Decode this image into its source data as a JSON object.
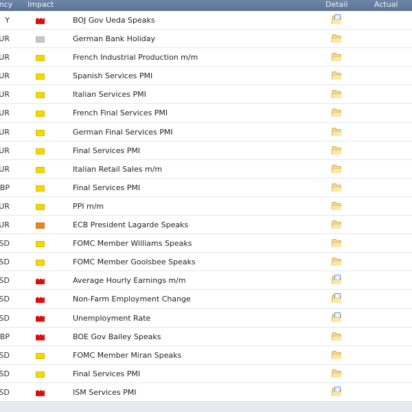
{
  "header": {
    "currency": "ency",
    "impact": "Impact",
    "detail": "Detail",
    "actual": "Actual"
  },
  "rows": [
    {
      "currency": "Y",
      "impact": "high",
      "event": "BOJ Gov Ueda Speaks",
      "detail_icon": "folder-doc-icon"
    },
    {
      "currency": "UR",
      "impact": "holiday",
      "event": "German Bank Holiday",
      "detail_icon": "folder-icon"
    },
    {
      "currency": "UR",
      "impact": "low",
      "event": "French Industrial Production m/m",
      "detail_icon": "folder-icon"
    },
    {
      "currency": "UR",
      "impact": "low",
      "event": "Spanish Services PMI",
      "detail_icon": "folder-icon"
    },
    {
      "currency": "UR",
      "impact": "low",
      "event": "Italian Services PMI",
      "detail_icon": "folder-icon"
    },
    {
      "currency": "UR",
      "impact": "low",
      "event": "French Final Services PMI",
      "detail_icon": "folder-icon"
    },
    {
      "currency": "UR",
      "impact": "low",
      "event": "German Final Services PMI",
      "detail_icon": "folder-icon"
    },
    {
      "currency": "UR",
      "impact": "low",
      "event": "Final Services PMI",
      "detail_icon": "folder-icon"
    },
    {
      "currency": "UR",
      "impact": "low",
      "event": "Italian Retail Sales m/m",
      "detail_icon": "folder-icon"
    },
    {
      "currency": "BP",
      "impact": "low",
      "event": "Final Services PMI",
      "detail_icon": "folder-icon"
    },
    {
      "currency": "UR",
      "impact": "low",
      "event": "PPI m/m",
      "detail_icon": "folder-icon"
    },
    {
      "currency": "UR",
      "impact": "medium",
      "event": "ECB President Lagarde Speaks",
      "detail_icon": "folder-icon"
    },
    {
      "currency": "SD",
      "impact": "low",
      "event": "FOMC Member Williams Speaks",
      "detail_icon": "folder-icon"
    },
    {
      "currency": "SD",
      "impact": "low",
      "event": "FOMC Member Goolsbee Speaks",
      "detail_icon": "folder-icon"
    },
    {
      "currency": "SD",
      "impact": "high",
      "event": "Average Hourly Earnings m/m",
      "detail_icon": "folder-doc-icon"
    },
    {
      "currency": "SD",
      "impact": "high",
      "event": "Non-Farm Employment Change",
      "detail_icon": "folder-doc-icon"
    },
    {
      "currency": "SD",
      "impact": "high",
      "event": "Unemployment Rate",
      "detail_icon": "folder-doc-icon"
    },
    {
      "currency": "BP",
      "impact": "high",
      "event": "BOE Gov Bailey Speaks",
      "detail_icon": "folder-icon"
    },
    {
      "currency": "SD",
      "impact": "low",
      "event": "FOMC Member Miran Speaks",
      "detail_icon": "folder-icon"
    },
    {
      "currency": "SD",
      "impact": "low",
      "event": "Final Services PMI",
      "detail_icon": "folder-icon"
    },
    {
      "currency": "SD",
      "impact": "high",
      "event": "ISM Services PMI",
      "detail_icon": "folder-doc-icon"
    }
  ],
  "colors": {
    "header_bg": "#5f789b",
    "impact_high": "#e00b0b",
    "impact_medium": "#e08a2a",
    "impact_low": "#f3d800",
    "impact_holiday": "#c8c8c8"
  }
}
